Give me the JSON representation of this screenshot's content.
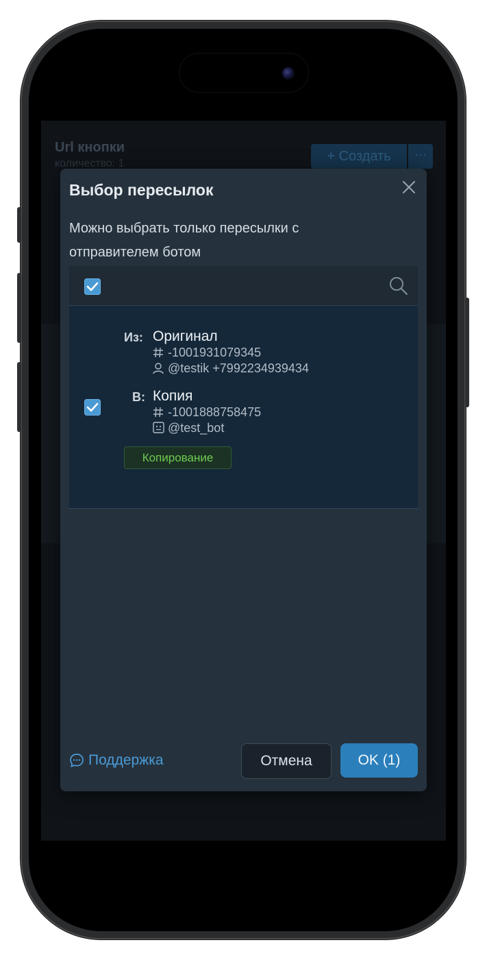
{
  "background": {
    "title": "Url кнопки",
    "count_label": "количество: 1",
    "create_label": "+ Создать",
    "more_label": "···"
  },
  "modal": {
    "title": "Выбор пересылок",
    "description": "Можно выбрать только пересылки с отправителем ботом",
    "select_all_checked": true,
    "rows": [
      {
        "checked": true,
        "from_label": "Из:",
        "from_name": "Оригинал",
        "from_chat_id": "-1001931079345",
        "from_user": "@testik +7992234939434",
        "to_label": "В:",
        "to_name": "Копия",
        "to_chat_id": "-1001888758475",
        "to_bot": "@test_bot",
        "mode_tag": "Копирование"
      }
    ],
    "support_label": "Поддержка",
    "cancel_label": "Отмена",
    "ok_label": "OK (1)"
  },
  "colors": {
    "accent": "#2b7fbb",
    "checkbox": "#4a9ad4",
    "tag_text": "#6fcb52",
    "modal_bg": "#25313c",
    "row_bg": "#15283a"
  },
  "icons": [
    "close-icon",
    "checkbox-icon",
    "search-icon",
    "hash-icon",
    "user-icon",
    "bot-icon",
    "chat-bubble-icon"
  ]
}
